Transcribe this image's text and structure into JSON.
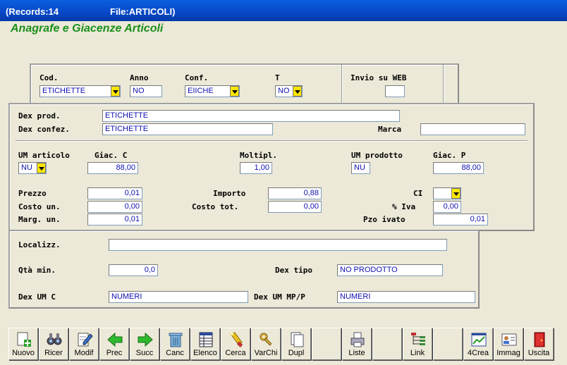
{
  "window": {
    "records": "(Records:14",
    "file": "File:ARTICOLI)"
  },
  "app_title": "Anagrafe e Giacenze Articoli",
  "top": {
    "cod_label": "Cod.",
    "cod_value": "ETICHETTE",
    "anno_label": "Anno",
    "anno_value": "NO",
    "conf_label": "Conf.",
    "conf_value": "EIICHE",
    "t_label": "T",
    "t_value": "NO",
    "web_label": "Invio su WEB",
    "web_value": ""
  },
  "product": {
    "dex_prod_label": "Dex prod.",
    "dex_prod_value": "ETICHETTE",
    "dex_confez_label": "Dex confez.",
    "dex_confez_value": "ETICHETTE",
    "marca_label": "Marca",
    "marca_value": "",
    "um_articolo_label": "UM articolo",
    "um_articolo_value": "NU",
    "giac_c_label": "Giac. C",
    "giac_c_value": "88,00",
    "moltipl_label": "Moltipl.",
    "moltipl_value": "1,00",
    "um_prodotto_label": "UM prodotto",
    "um_prodotto_value": "NU",
    "giac_p_label": "Giac. P",
    "giac_p_value": "88,00",
    "prezzo_label": "Prezzo",
    "prezzo_value": "0,01",
    "importo_label": "Importo",
    "importo_value": "0,88",
    "ci_label": "CI",
    "ci_value": "",
    "costo_un_label": "Costo un.",
    "costo_un_value": "0,00",
    "costo_tot_label": "Costo tot.",
    "costo_tot_value": "0,00",
    "iva_label": "% Iva",
    "iva_value": "0,00",
    "marg_un_label": "Marg. un.",
    "marg_un_value": "0,01",
    "pzo_ivato_label": "Pzo ivato",
    "pzo_ivato_value": "0,01"
  },
  "location": {
    "localizz_label": "Localizz.",
    "localizz_value": "",
    "qta_min_label": "Qtà min.",
    "qta_min_value": "0,0",
    "dex_tipo_label": "Dex tipo",
    "dex_tipo_value": "NO PRODOTTO",
    "dex_um_c_label": "Dex UM C",
    "dex_um_c_value": "NUMERI",
    "dex_um_mpp_label": "Dex UM MP/P",
    "dex_um_mpp_value": "NUMERI"
  },
  "toolbar": {
    "nuovo": "Nuovo",
    "ricer": "Ricer",
    "modif": "Modif",
    "prec": "Prec",
    "succ": "Succ",
    "canc": "Canc",
    "elenco": "Elenco",
    "cerca": "Cerca",
    "varchi": "VarChi",
    "dupl": "Dupl",
    "liste": "Liste",
    "link": "Link",
    "crea4": "4Crea",
    "immag": "Immag",
    "uscita": "Uscita"
  },
  "colors": {
    "title_green": "#1a8f1a",
    "value_blue": "#1010b0",
    "dropdown_yellow": "#ffe600",
    "titlebar_blue": "#0747c6"
  }
}
